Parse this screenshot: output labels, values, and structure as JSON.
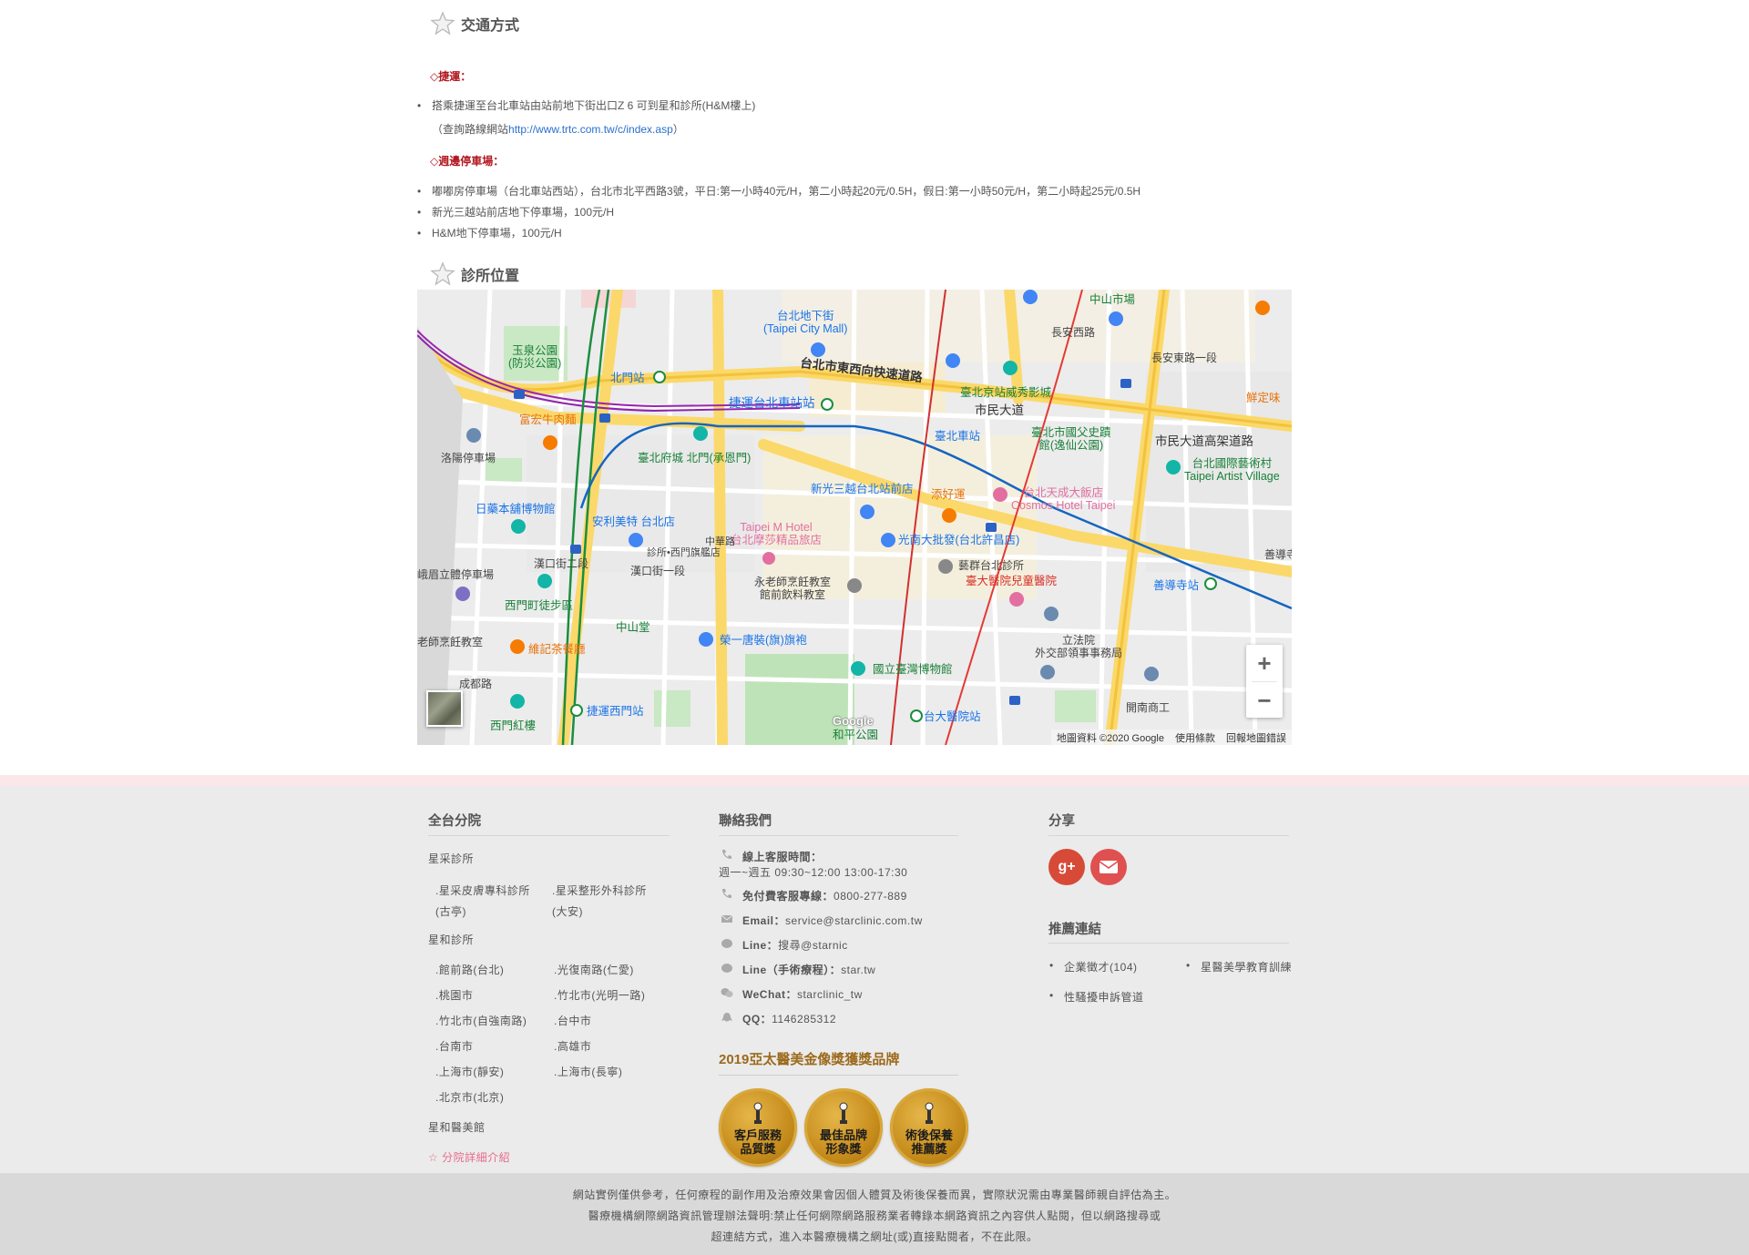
{
  "transport": {
    "title": "交通方式",
    "mrt_heading": "◇捷運：",
    "mrt_line1": "搭乘捷運至台北車站由站前地下街出口Z 6 可到星和診所(H&M樓上)",
    "mrt_line2_prefix": "（查詢路線網站",
    "mrt_link": "http://www.trtc.com.tw/c/index.asp",
    "mrt_line2_suffix": "）",
    "parking_heading": "◇週邊停車場：",
    "parking": [
      "嘟嘟房停車場（台北車站西站），台北市北平西路3號，平日:第一小時40元/H，第二小時起20元/0.5H，假日:第一小時50元/H，第二小時起25元/0.5H",
      "新光三越站前店地下停車場，100元/H",
      "H&M地下停車場，100元/H"
    ]
  },
  "location": {
    "title": "診所位置",
    "map": {
      "labels": {
        "city_mall": "台北地下街\n(Taipei City Mall)",
        "yuquan_park": "玉泉公園\n(防災公園)",
        "beimen_station": "北門站",
        "expressway": "台北市東西向快速道路",
        "taipei_main_mrt": "捷運台北車站站",
        "xinyong": "富宏牛肉麵",
        "luoyang_parking": "洛陽停車場",
        "beimen_gate": "臺北府城 北門(承恩門)",
        "taipei_station": "臺北車站",
        "xiushow": "臺北京站威秀影城",
        "citizen_blvd": "市民大道",
        "sun_yat_sen": "臺北市國父史蹟\n館(逸仙公園)",
        "citizen_elevated": "市民大道高架道路",
        "arts_village": "台北國際藝術村\nTaipei Artist Village",
        "zhongshan_market": "中山市場",
        "changan_rd": "長安西路",
        "changan_e": "長安東路一段",
        "xianguangwei": "鮮定味",
        "rizao_museum": "日藥本舖博物館",
        "shinkong": "新光三越台北站前店",
        "tianhao": "添好運",
        "cosmos": "台北天成大飯店\nCosmos Hotel Taipei",
        "anlimeite": "安利美特 台北店",
        "taipei_m": "Taipei M Hotel\n台北摩莎精品旅店",
        "guangnan": "光南大批發(台北許昌店)",
        "xingqun": "藝群台北診所",
        "ntuh_children": "臺大醫院兒童醫院",
        "shandao_station": "善導寺站",
        "hankou2": "漢口街二段",
        "hankou1": "漢口街一段",
        "emei_parking": "峨眉立體停車場",
        "ximen_walk": "西門町徒步區",
        "yonglao": "永老師烹飪教室\n館前飲料教室",
        "zhongshan_hall": "中山堂",
        "rongyi": "榮一唐裝(旗)旗袍",
        "legislative": "立法院\n外交部領事事務局",
        "teacher_cook": "老師烹飪教室",
        "weiji_tea": "維記茶餐廳",
        "ntm": "國立臺灣博物館",
        "chengdu_rd": "成都路",
        "ximen_red": "西門紅樓",
        "ximen_mrt": "捷運西門站",
        "ntuh_station": "台大醫院站",
        "kaifeng_school": "開南商工",
        "heping_park": "和平公園",
        "zhonghua_rd": "中華路",
        "ximen_qipao": "診所•西門旗艦店",
        "shandao": "善導寺"
      },
      "attribution": "地圖資料 ©2020 Google",
      "terms": "使用條款",
      "report": "回報地圖錯誤",
      "zoom_in": "+",
      "zoom_out": "−",
      "google_logo": "Google"
    }
  },
  "footer": {
    "branches": {
      "title": "全台分院",
      "group1_title": "星采診所",
      "group1": [
        ".星采皮膚專科診所\n(古亭)",
        ".星采整形外科診所\n(大安)"
      ],
      "group2_title": "星和診所",
      "group2": [
        ".館前路(台北)",
        ".光復南路(仁愛)",
        ".桃園市",
        ".竹北市(光明一路)",
        ".竹北市(自強南路)",
        ".台中市",
        ".台南市",
        ".高雄市",
        ".上海市(靜安)",
        ".上海市(長寧)",
        ".北京市(北京)"
      ],
      "group3_title": "星和醫美館",
      "detail_link": "分院詳細介紹"
    },
    "contact": {
      "title": "聯絡我們",
      "hours_label": "線上客服時間：",
      "hours_value": "週一~週五 09:30~12:00 13:00-17:30",
      "phone_label": "免付費客服專線：",
      "phone_value": "0800-277-889",
      "email_label": "Email：",
      "email_value": "service@starclinic.com.tw",
      "line1_label": "Line：",
      "line1_value": "搜尋@starnic",
      "line2_label": "Line（手術療程）：",
      "line2_value": "star.tw",
      "wechat_label": "WeChat：",
      "wechat_value": "starclinic_tw",
      "qq_label": "QQ：",
      "qq_value": "1146285312",
      "award_title": "2019亞太醫美金像獎獲獎品牌",
      "awards": [
        "客戶服務\n品質獎",
        "最佳品牌\n形象獎",
        "術後保養\n推薦獎"
      ]
    },
    "share": {
      "title": "分享",
      "gplus": "g+",
      "rec_title": "推薦連結",
      "links": [
        "企業徵才(104)",
        "星醫美學教育訓練",
        "性騷擾申訴管道"
      ]
    },
    "disclaimer": [
      "網站實例僅供參考，任何療程的副作用及治療效果會因個人體質及術後保養而異，實際狀況需由專業醫師親自評估為主。",
      "醫療機構網際網路資訊管理辦法聲明:禁止任何網際網路服務業者轉錄本網路資訊之內容供人點閱，但以網路搜尋或",
      "超連結方式，進入本醫療機構之網址(或)直接點閱者，不在此限。"
    ]
  }
}
